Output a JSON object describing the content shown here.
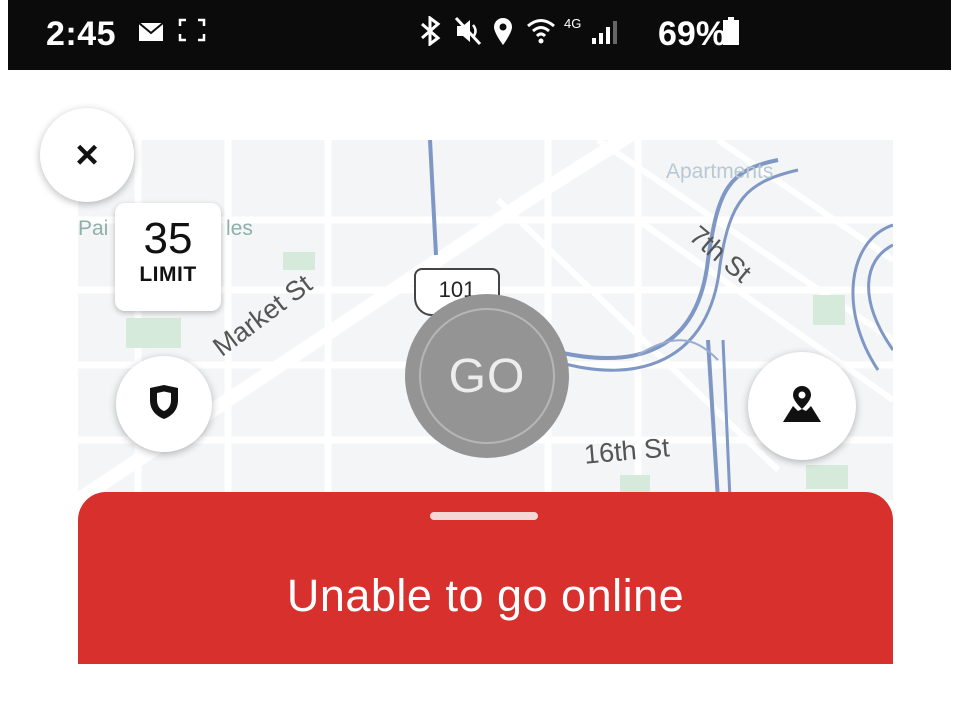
{
  "status_bar": {
    "time": "2:45",
    "battery": "69%",
    "icons": [
      "mail-icon",
      "screenshot-icon",
      "bluetooth-icon",
      "mute-icon",
      "location-icon",
      "wifi-icon",
      "lte-icon",
      "signal-icon",
      "battery-icon"
    ]
  },
  "map": {
    "speed_limit_value": "35",
    "speed_limit_label": "LIMIT",
    "highway_shield": "101",
    "streets": [
      "Market St",
      "7th St",
      "16th St"
    ],
    "faint_labels": [
      "Apartments",
      "Pai",
      "les"
    ]
  },
  "buttons": {
    "close_icon": "×",
    "go_label": "GO"
  },
  "bottom_sheet": {
    "title": "Unable to go online",
    "color": "#d8302c"
  },
  "colors": {
    "go_button": "#949494",
    "route": "#7f97c4",
    "status_bar": "#0b0b0b"
  }
}
